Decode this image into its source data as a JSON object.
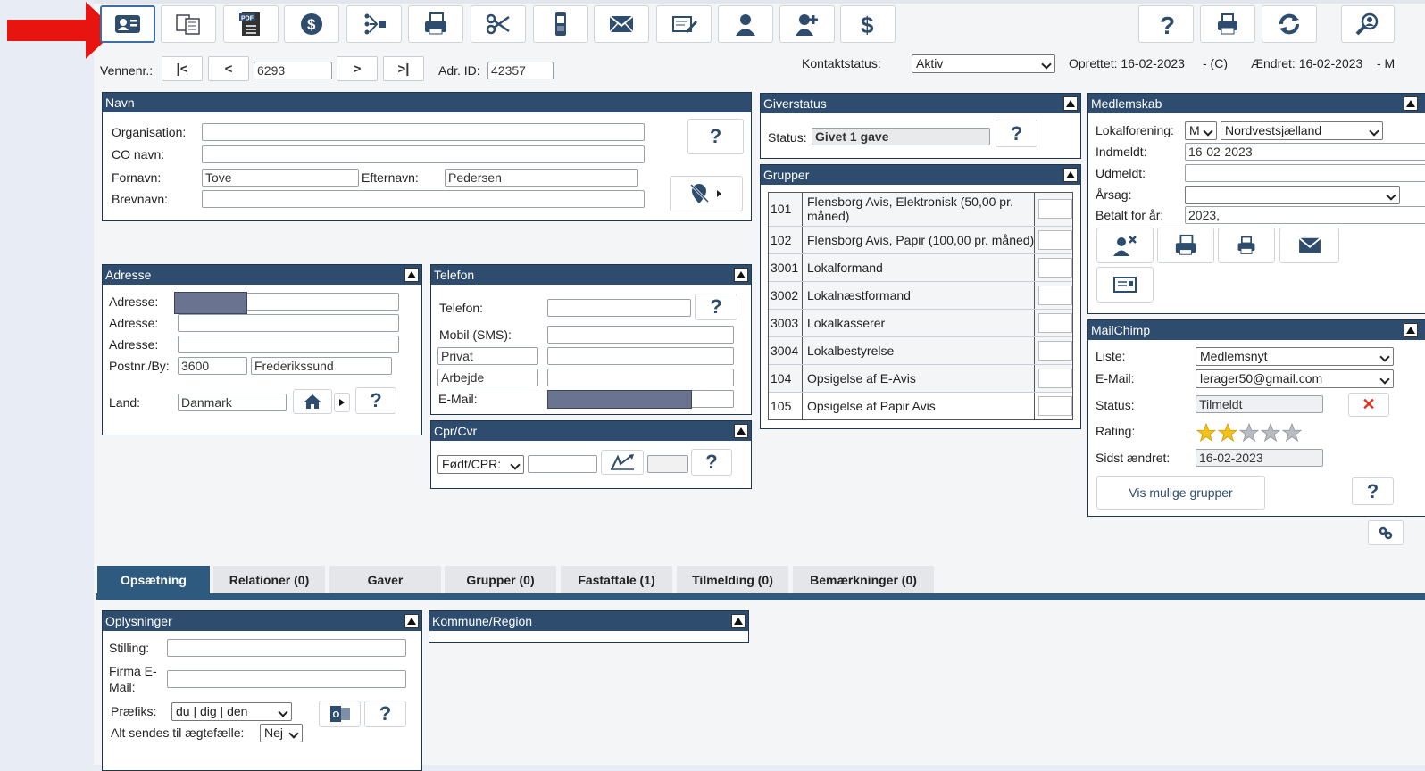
{
  "toolbar": {
    "icons": [
      "contact-card-icon",
      "copy-records-icon",
      "pdf-document-icon",
      "dollar-circle-icon",
      "distribute-icon",
      "print-labels-icon",
      "scissors-icon",
      "mobile-phone-icon",
      "envelope-icon",
      "edit-letter-icon",
      "person-icon",
      "add-person-icon",
      "dollar-icon",
      "help-icon",
      "printer-icon",
      "refresh-icon",
      "search-person-icon"
    ],
    "pdf_badge": "PDF"
  },
  "nav": {
    "vennenr_label": "Vennenr.:",
    "first": "|<",
    "prev": "<",
    "next": ">",
    "last": ">|",
    "vennenr_value": "6293",
    "adr_id_label": "Adr. ID:",
    "adr_id_value": "42357",
    "kontaktstatus_label": "Kontaktstatus:",
    "kontaktstatus_value": "Aktiv",
    "oprettet": "Oprettet: 16-02-2023",
    "oprettet_suffix": "- (C)",
    "aendret": "Ændret: 16-02-2023",
    "aendret_suffix": "- M"
  },
  "navn": {
    "title": "Navn",
    "organisation_label": "Organisation:",
    "co_label": "CO navn:",
    "fornavn_label": "Fornavn:",
    "fornavn_value": "Tove",
    "efternavn_label": "Efternavn:",
    "efternavn_value": "Pedersen",
    "brevnavn_label": "Brevnavn:",
    "help": "?"
  },
  "adresse": {
    "title": "Adresse",
    "adresse_label": "Adresse:",
    "postnr_label": "Postnr./By:",
    "postnr_value": "3600",
    "by_value": "Frederikssund",
    "land_label": "Land:",
    "land_value": "Danmark",
    "help": "?"
  },
  "telefon": {
    "title": "Telefon",
    "telefon_label": "Telefon:",
    "mobil_label": "Mobil (SMS):",
    "privat_label": "Privat",
    "arbejde_label": "Arbejde",
    "email_label": "E-Mail:",
    "help": "?"
  },
  "cpr": {
    "title": "Cpr/Cvr",
    "select_value": "Født/CPR:",
    "help": "?"
  },
  "giverstatus": {
    "title": "Giverstatus",
    "status_label": "Status:",
    "status_value": "Givet 1 gave",
    "help": "?"
  },
  "grupper": {
    "title": "Grupper",
    "rows": [
      {
        "id": "101",
        "name": "Flensborg Avis, Elektronisk (50,00 pr.",
        "name2": "måned)"
      },
      {
        "id": "102",
        "name": "Flensborg Avis, Papir (100,00 pr. måned)"
      },
      {
        "id": "3001",
        "name": "Lokalformand"
      },
      {
        "id": "3002",
        "name": "Lokalnæstformand"
      },
      {
        "id": "3003",
        "name": "Lokalkasserer"
      },
      {
        "id": "3004",
        "name": "Lokalbestyrelse"
      },
      {
        "id": "104",
        "name": "Opsigelse af E-Avis"
      },
      {
        "id": "105",
        "name": "Opsigelse af Papir Avis"
      }
    ]
  },
  "medlemskab": {
    "title": "Medlemskab",
    "lokalforening_label": "Lokalforening:",
    "lokal_short": "M",
    "lokal_value": "Nordvestsjælland",
    "indmeldt_label": "Indmeldt:",
    "indmeldt_value": "16-02-2023",
    "udmeldt_label": "Udmeldt:",
    "aarsag_label": "Årsag:",
    "betalt_label": "Betalt for år:",
    "betalt_value": "2023,"
  },
  "mailchimp": {
    "title": "MailChimp",
    "liste_label": "Liste:",
    "liste_value": "Medlemsnyt",
    "email_label": "E-Mail:",
    "email_value": "lerager50@gmail.com",
    "status_label": "Status:",
    "status_value": "Tilmeldt",
    "rating_label": "Rating:",
    "rating_value": 2,
    "rating_max": 5,
    "sidst_label": "Sidst ændret:",
    "sidst_value": "16-02-2023",
    "vis_button": "Vis mulige grupper",
    "help": "?",
    "remove": "✕"
  },
  "tabs": [
    {
      "label": "Opsætning",
      "active": true
    },
    {
      "label": "Relationer (0)"
    },
    {
      "label": "Gaver"
    },
    {
      "label": "Grupper (0)"
    },
    {
      "label": "Fastaftale (1)"
    },
    {
      "label": "Tilmelding (0)"
    },
    {
      "label": "Bemærkninger (0)"
    }
  ],
  "oplysninger": {
    "title": "Oplysninger",
    "stilling_label": "Stilling:",
    "firma_label_1": "Firma E-",
    "firma_label_2": "Mail:",
    "praefiks_label": "Præfiks:",
    "praefiks_value": "du | dig | den",
    "aegtefaelle_label": "Alt sendes til ægtefælle:",
    "aegtefaelle_value": "Nej",
    "help": "?"
  },
  "kommune": {
    "title": "Kommune/Region"
  },
  "colors": {
    "header": "#2e4c6d",
    "tab_active": "#2e5a80",
    "arrow": "#e8140f",
    "star": "#f2c21a"
  }
}
